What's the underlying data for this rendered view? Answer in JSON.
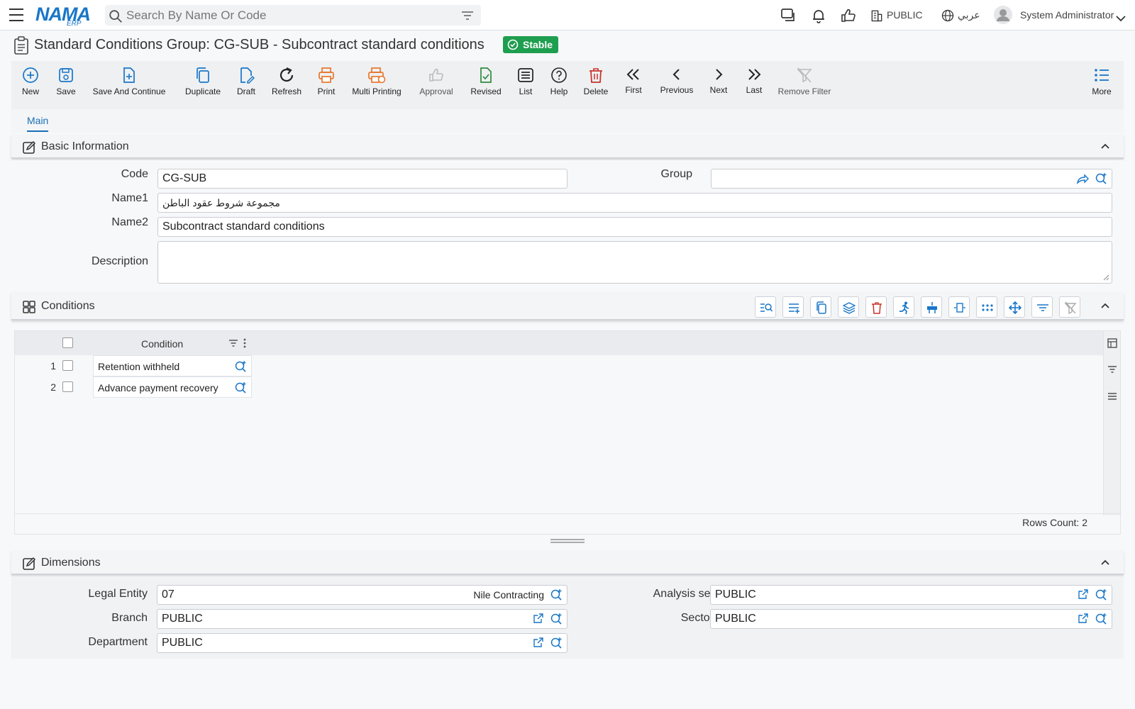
{
  "header": {
    "logo_text": "NAMA",
    "logo_sub": "ERP",
    "search_placeholder": "Search By Name Or Code",
    "company": "PUBLIC",
    "language": "عربي",
    "user": "System Administrator"
  },
  "page": {
    "title": "Standard Conditions Group: CG-SUB - Subcontract standard conditions",
    "status": "Stable"
  },
  "toolbar": {
    "new": "New",
    "save": "Save",
    "save_continue": "Save And Continue",
    "duplicate": "Duplicate",
    "draft": "Draft",
    "refresh": "Refresh",
    "print": "Print",
    "multi_printing": "Multi Printing",
    "approval": "Approval",
    "revised": "Revised",
    "list": "List",
    "help": "Help",
    "delete": "Delete",
    "first": "First",
    "previous": "Previous",
    "next": "Next",
    "last": "Last",
    "remove_filter": "Remove Filter",
    "more": "More"
  },
  "tabs": [
    {
      "label": "Main"
    }
  ],
  "basic_info": {
    "title": "Basic Information",
    "code_label": "Code",
    "code_value": "CG-SUB",
    "group_label": "Group",
    "group_value": "",
    "name1_label": "Name1",
    "name1_value": "مجموعة شروط عقود الباطن",
    "name2_label": "Name2",
    "name2_value": "Subcontract standard conditions",
    "description_label": "Description",
    "description_value": ""
  },
  "conditions": {
    "title": "Conditions",
    "column_header": "Condition",
    "rows": [
      {
        "num": "1",
        "condition": "Retention withheld"
      },
      {
        "num": "2",
        "condition": "Advance payment recovery"
      }
    ],
    "rows_count": "Rows Count: 2"
  },
  "dimensions": {
    "title": "Dimensions",
    "legal_entity_label": "Legal Entity",
    "legal_entity_value": "07",
    "legal_entity_name": "Nile Contracting",
    "analysis_set_label": "Analysis set",
    "analysis_set_value": "PUBLIC",
    "branch_label": "Branch",
    "branch_value": "PUBLIC",
    "sector_label": "Sector",
    "sector_value": "PUBLIC",
    "department_label": "Department",
    "department_value": "PUBLIC"
  },
  "colors": {
    "accent": "#1976c8",
    "stable": "#1e9e4f",
    "print": "#e8762c",
    "delete": "#c8332b",
    "revised": "#2e8b3f"
  }
}
